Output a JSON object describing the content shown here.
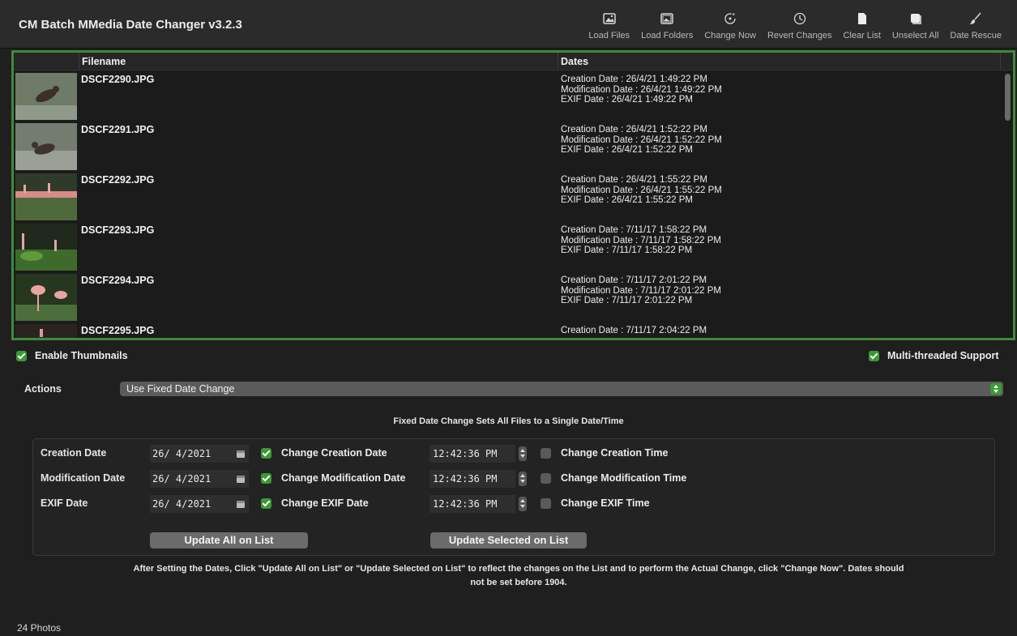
{
  "app": {
    "title": "CM Batch MMedia Date Changer v3.2.3"
  },
  "toolbar": {
    "items": [
      {
        "label": "Load Files",
        "icon": "image-icon"
      },
      {
        "label": "Load Folders",
        "icon": "folder-image-icon"
      },
      {
        "label": "Change Now",
        "icon": "refresh-icon"
      },
      {
        "label": "Revert Changes",
        "icon": "clock-undo-icon"
      },
      {
        "label": "Clear List",
        "icon": "document-icon"
      },
      {
        "label": "Unselect All",
        "icon": "square-icon"
      },
      {
        "label": "Date Rescue",
        "icon": "brush-icon"
      }
    ]
  },
  "list": {
    "headers": {
      "filename": "Filename",
      "dates": "Dates"
    },
    "rows": [
      {
        "filename": "DSCF2290.JPG",
        "creation": "Creation Date : 26/4/21 1:49:22 PM",
        "modification": "Modification Date : 26/4/21 1:49:22 PM",
        "exif": "EXIF Date : 26/4/21 1:49:22 PM"
      },
      {
        "filename": "DSCF2291.JPG",
        "creation": "Creation Date : 26/4/21 1:52:22 PM",
        "modification": "Modification Date : 26/4/21 1:52:22 PM",
        "exif": "EXIF Date : 26/4/21 1:52:22 PM"
      },
      {
        "filename": "DSCF2292.JPG",
        "creation": "Creation Date : 26/4/21 1:55:22 PM",
        "modification": "Modification Date : 26/4/21 1:55:22 PM",
        "exif": "EXIF Date : 26/4/21 1:55:22 PM"
      },
      {
        "filename": "DSCF2293.JPG",
        "creation": "Creation Date : 7/11/17 1:58:22 PM",
        "modification": "Modification Date : 7/11/17 1:58:22 PM",
        "exif": "EXIF Date : 7/11/17 1:58:22 PM"
      },
      {
        "filename": "DSCF2294.JPG",
        "creation": "Creation Date : 7/11/17 2:01:22 PM",
        "modification": "Modification Date : 7/11/17 2:01:22 PM",
        "exif": "EXIF Date : 7/11/17 2:01:22 PM"
      },
      {
        "filename": "DSCF2295.JPG",
        "creation": "Creation Date : 7/11/17 2:04:22 PM",
        "modification": "",
        "exif": ""
      }
    ]
  },
  "options": {
    "thumbnails": "Enable Thumbnails",
    "multithread": "Multi-threaded Support"
  },
  "actions": {
    "label": "Actions",
    "selected": "Use Fixed Date Change"
  },
  "fixed": {
    "description": "Fixed Date Change Sets All Files to a Single Date/Time",
    "rows": [
      {
        "label": "Creation Date",
        "date": "26/ 4/2021",
        "change_date_label": "Change Creation Date",
        "time": "12:42:36 PM",
        "change_time_label": "Change Creation Time"
      },
      {
        "label": "Modification Date",
        "date": "26/ 4/2021",
        "change_date_label": "Change Modification Date",
        "time": "12:42:36 PM",
        "change_time_label": "Change Modification Time"
      },
      {
        "label": "EXIF Date",
        "date": "26/ 4/2021",
        "change_date_label": "Change EXIF Date",
        "time": "12:42:36 PM",
        "change_time_label": "Change EXIF Time"
      }
    ],
    "update_all": "Update All on List",
    "update_selected": "Update Selected on List"
  },
  "note": {
    "line1": "After Setting the Dates, Click \"Update All on List\" or \"Update Selected on List\" to reflect the changes on the List and to perform the Actual Change, click \"Change Now\". Dates should",
    "line2": "not be set before 1904."
  },
  "status": {
    "count": "24 Photos"
  },
  "colors": {
    "accent": "#3a9a35",
    "background": "#1f1f1f",
    "list_border": "#3e8a3a"
  }
}
